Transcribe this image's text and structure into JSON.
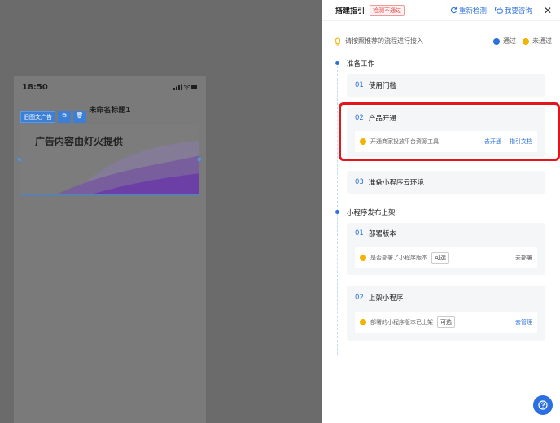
{
  "preview": {
    "time": "18:50",
    "page_title": "未命名标题1",
    "ad_tag": "旧图文广告",
    "ad_text": "广告内容由灯火提供"
  },
  "panel": {
    "title": "搭建指引",
    "status_badge": "检测不通过",
    "recheck_label": "重新检测",
    "consult_label": "我要咨询",
    "hint": "请按照推荐的流程进行接入",
    "legend_pass": "通过",
    "legend_fail": "未通过"
  },
  "sections": [
    {
      "title": "准备工作",
      "steps": [
        {
          "num": "01",
          "label": "使用门槛"
        },
        {
          "num": "02",
          "label": "产品开通",
          "sub": {
            "text": "开通商家投放平台资源工具",
            "actions": [
              "去开通",
              "指引文档"
            ]
          }
        },
        {
          "num": "03",
          "label": "准备小程序云环境"
        }
      ]
    },
    {
      "title": "小程序发布上架",
      "steps": [
        {
          "num": "01",
          "label": "部署版本",
          "sub": {
            "text": "是否部署了小程序版本",
            "tag": "可选",
            "action": "去部署"
          }
        },
        {
          "num": "02",
          "label": "上架小程序",
          "sub": {
            "text": "部署的小程序版本已上架",
            "tag": "可选",
            "action": "去管理"
          }
        }
      ]
    }
  ],
  "colors": {
    "accent": "#2b6fe0",
    "warn": "#f4b300",
    "error": "#e3161b"
  },
  "icons": [
    "refresh-icon",
    "chat-icon",
    "close-icon",
    "bulb-icon",
    "help-icon"
  ]
}
